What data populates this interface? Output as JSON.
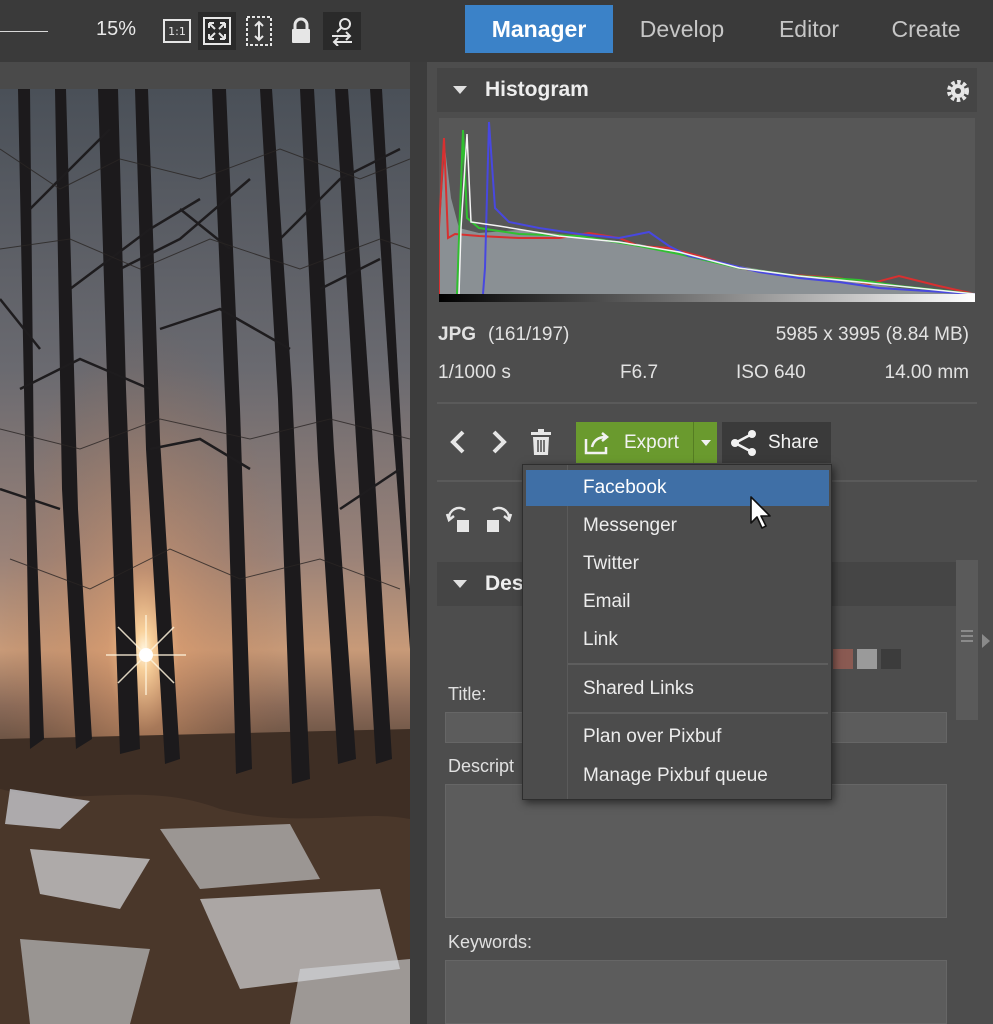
{
  "toolbar": {
    "zoom_value": "15%",
    "icons": [
      "actual-size-icon",
      "fit-screen-icon",
      "fit-height-icon",
      "lock-icon",
      "person-swap-icon"
    ]
  },
  "tabs": [
    {
      "label": "Manager",
      "selected": true
    },
    {
      "label": "Develop",
      "selected": false
    },
    {
      "label": "Editor",
      "selected": false
    },
    {
      "label": "Create",
      "selected": false
    }
  ],
  "histogram": {
    "title": "Histogram"
  },
  "file_info": {
    "format": "JPG",
    "index": "(161/197)",
    "dimensions": "5985 x 3995 (8.84 MB)",
    "shutter": "1/1000 s",
    "aperture": "F6.7",
    "iso": "ISO 640",
    "focal": "14.00 mm"
  },
  "actions": {
    "export_label": "Export",
    "share_label": "Share"
  },
  "share_menu": {
    "items": [
      "Facebook",
      "Messenger",
      "Twitter",
      "Email",
      "Link"
    ],
    "shared_links": "Shared Links",
    "pixbuf_items": [
      "Plan over Pixbuf",
      "Manage Pixbuf queue"
    ],
    "highlighted": "Facebook"
  },
  "description_section": {
    "title": "Des",
    "title_label": "Title:",
    "description_label": "Descript",
    "keywords_label": "Keywords:"
  },
  "colors": {
    "accent": "#3b82c8",
    "export_green": "#6a9a2e",
    "menu_highlight": "#3f6fa6"
  }
}
